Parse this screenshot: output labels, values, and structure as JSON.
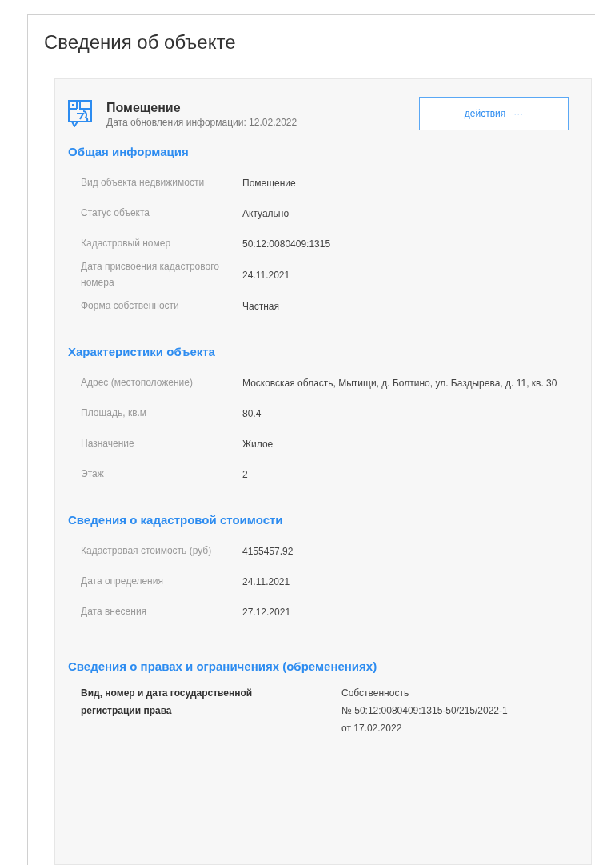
{
  "page_title": "Сведения об объекте",
  "object": {
    "name": "Помещение",
    "updated": "Дата обновления информации: 12.02.2022",
    "actions_button": {
      "label": "действия",
      "dots": "···"
    }
  },
  "sections": [
    {
      "title": "Общая информация",
      "rows": [
        {
          "label": "Вид объекта недвижимости",
          "value": "Помещение"
        },
        {
          "label": "Статус объекта",
          "value": "Актуально"
        },
        {
          "label": "Кадастровый номер",
          "value": "50:12:0080409:1315"
        },
        {
          "label": "Дата присвоения кадастрового номера",
          "value": "24.11.2021"
        },
        {
          "label": "Форма собственности",
          "value": "Частная"
        }
      ]
    },
    {
      "title": "Характеристики объекта",
      "rows": [
        {
          "label": "Адрес (местоположение)",
          "value": "Московская область, Мытищи, д. Болтино, ул. Баздырева, д. 11, кв. 30"
        },
        {
          "label": "Площадь, кв.м",
          "value": "80.4"
        },
        {
          "label": "Назначение",
          "value": "Жилое"
        },
        {
          "label": "Этаж",
          "value": "2"
        }
      ]
    },
    {
      "title": "Сведения о кадастровой стоимости",
      "rows": [
        {
          "label": "Кадастровая стоимость (руб)",
          "value": "4155457.92"
        },
        {
          "label": "Дата определения",
          "value": "24.11.2021"
        },
        {
          "label": "Дата внесения",
          "value": "27.12.2021"
        }
      ]
    }
  ],
  "rights": {
    "title": "Сведения о правах и ограничениях (обременениях)",
    "label": "Вид, номер и дата государственной регистрации права",
    "value_lines": [
      "Собственность",
      "№ 50:12:0080409:1315-50/215/2022-1",
      "от 17.02.2022"
    ]
  }
}
